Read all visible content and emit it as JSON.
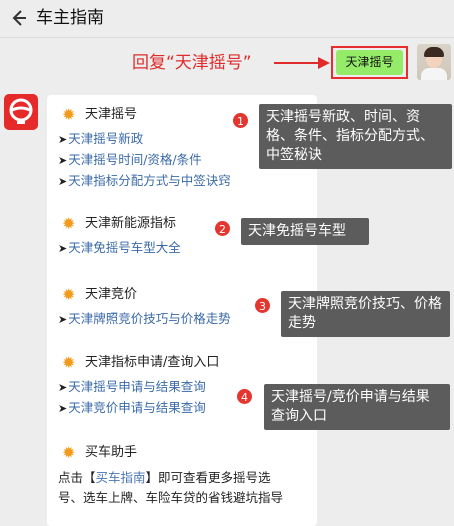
{
  "header": {
    "title": "车主指南",
    "back_icon": "back-arrow-icon"
  },
  "hint": {
    "text": "回复“天津摇号”",
    "keyword": "天津摇号",
    "color": "#e02b2b"
  },
  "bubble_color": "#95ec69",
  "sections": [
    {
      "title": "天津摇号",
      "links": [
        "天津摇号新政",
        "天津摇号时间/资格/条件",
        "天津指标分配方式与中签诀窍"
      ]
    },
    {
      "title": "天津新能源指标",
      "links": [
        "天津免摇号车型大全"
      ]
    },
    {
      "title": "天津竞价",
      "links": [
        "天津牌照竞价技巧与价格走势"
      ]
    },
    {
      "title": "天津指标申请/查询入口",
      "links": [
        "天津摇号申请与结果查询",
        "天津竞价申请与结果查询"
      ]
    },
    {
      "title": "买车助手",
      "text_pre": "点击【",
      "text_link": "买车指南",
      "text_post": "】即可查看更多摇号选号、选车上牌、车险车贷的省钱避坑指导"
    }
  ],
  "notes": [
    {
      "number": "1",
      "text": "天津摇号新政、时间、资格、条件、指标分配方式、中签秘诀"
    },
    {
      "number": "2",
      "text": "天津免摇号车型"
    },
    {
      "number": "3",
      "text": "天津牌照竞价技巧、价格走势"
    },
    {
      "number": "4",
      "text": "天津摇号/竞价申请与结果查询入口"
    }
  ]
}
